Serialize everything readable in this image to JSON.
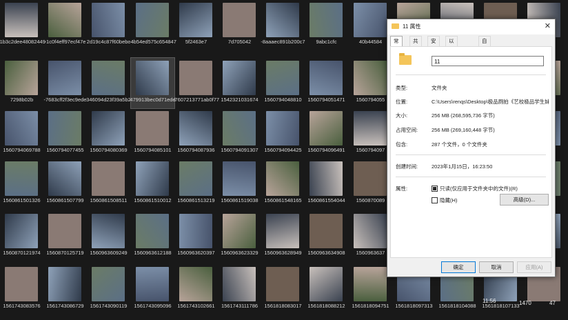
{
  "thumb_palette": [
    "#5b6f86",
    "#3a4250",
    "#8a7a74",
    "#c9c1bc",
    "#6b7c66",
    "#47536b",
    "#b8a49a",
    "#2f3a4a",
    "#6e5e52",
    "#8fa2b9",
    "#4a5f3e",
    "#7c8fa8"
  ],
  "tiles": [
    {
      "label": "-1b3c2dee48082449"
    },
    {
      "label": "-1c0f4eff97ecf47e"
    },
    {
      "label": "2d19c4c87f60bebc"
    },
    {
      "label": "-4b54ed575c654847"
    },
    {
      "label": "5f2463e7"
    },
    {
      "label": "7d705042"
    },
    {
      "label": "-8aaaec891b200c7"
    },
    {
      "label": "9abc1cfc"
    },
    {
      "label": "40b44584"
    },
    {
      "label": ""
    },
    {
      "label": ""
    },
    {
      "label": ""
    },
    {
      "label": ""
    },
    {
      "label": "7298b02b"
    },
    {
      "label": "-7683cff2f3ec9ede"
    },
    {
      "label": "346094d23f39a5b2"
    },
    {
      "label": "479913bec0d71edd"
    },
    {
      "label": "-7607213771ab0f77"
    },
    {
      "label": "1542321031674"
    },
    {
      "label": "1560794048810"
    },
    {
      "label": "1560794051471"
    },
    {
      "label": "1560794055"
    },
    {
      "label": ""
    },
    {
      "label": ""
    },
    {
      "label": ""
    },
    {
      "label": ""
    },
    {
      "label": "1560794069788"
    },
    {
      "label": "1560794077455"
    },
    {
      "label": "1560794080369"
    },
    {
      "label": "1560794085101"
    },
    {
      "label": "1560794087936"
    },
    {
      "label": "1560794091307"
    },
    {
      "label": "1560794094425"
    },
    {
      "label": "1560794096491"
    },
    {
      "label": "1560794097"
    },
    {
      "label": ""
    },
    {
      "label": ""
    },
    {
      "label": ""
    },
    {
      "label": ""
    },
    {
      "label": "1560861501326"
    },
    {
      "label": "1560861507799"
    },
    {
      "label": "1560861508511"
    },
    {
      "label": "1560861510012"
    },
    {
      "label": "1560861513219"
    },
    {
      "label": "1560861519038"
    },
    {
      "label": "1560861548165"
    },
    {
      "label": "1560861554044"
    },
    {
      "label": "1560870089"
    },
    {
      "label": ""
    },
    {
      "label": ""
    },
    {
      "label": ""
    },
    {
      "label": ""
    },
    {
      "label": "1560870121974"
    },
    {
      "label": "1560870125719"
    },
    {
      "label": "1560963609249"
    },
    {
      "label": "1560963612188"
    },
    {
      "label": "1560963620397"
    },
    {
      "label": "1560963623329"
    },
    {
      "label": "1560963628949"
    },
    {
      "label": "1560963634908"
    },
    {
      "label": "1560963637"
    },
    {
      "label": ""
    },
    {
      "label": ""
    },
    {
      "label": ""
    },
    {
      "label": ""
    },
    {
      "label": "1561743083576"
    },
    {
      "label": "1561743086729"
    },
    {
      "label": "1561743090119"
    },
    {
      "label": "1561743095096"
    },
    {
      "label": "1561743102661"
    },
    {
      "label": "1561743111786"
    },
    {
      "label": "1561818083017"
    },
    {
      "label": "1561818088212"
    },
    {
      "label": "1561818094751"
    },
    {
      "label": "1561818097313"
    },
    {
      "label": "1561818104088"
    },
    {
      "label": "1561818107133"
    },
    {
      "label": ""
    }
  ],
  "dialog": {
    "title": "11 属性",
    "close_glyph": "✕",
    "tabs": [
      "常规",
      "共享",
      "安全",
      "以前的版本",
      "自定义"
    ],
    "folder_name": "11",
    "rows": [
      {
        "label": "类型:",
        "value": "文件夹"
      },
      {
        "label": "位置:",
        "value": "C:\\Users\\renqs\\Desktop\\极品厕拍《艺校极品学生妹"
      },
      {
        "label": "大小:",
        "value": "256 MB (268,595,736 字节)"
      },
      {
        "label": "占用空间:",
        "value": "256 MB (269,160,448 字节)"
      },
      {
        "label": "包含:",
        "value": "287 个文件，0 个文件夹"
      },
      {
        "label": "创建时间:",
        "value": "2023年1月15日，16:23:50"
      }
    ],
    "attributes_label": "属性:",
    "readonly_label": "只读(仅应用于文件夹中的文件)(R)",
    "hidden_label": "隐藏(H)",
    "advanced_label": "高级(D)...",
    "ok_label": "确定",
    "cancel_label": "取消",
    "apply_label": "应用(A)"
  },
  "overlay": {
    "line1": "11:56",
    "line2": "1470",
    "line3": "47"
  }
}
